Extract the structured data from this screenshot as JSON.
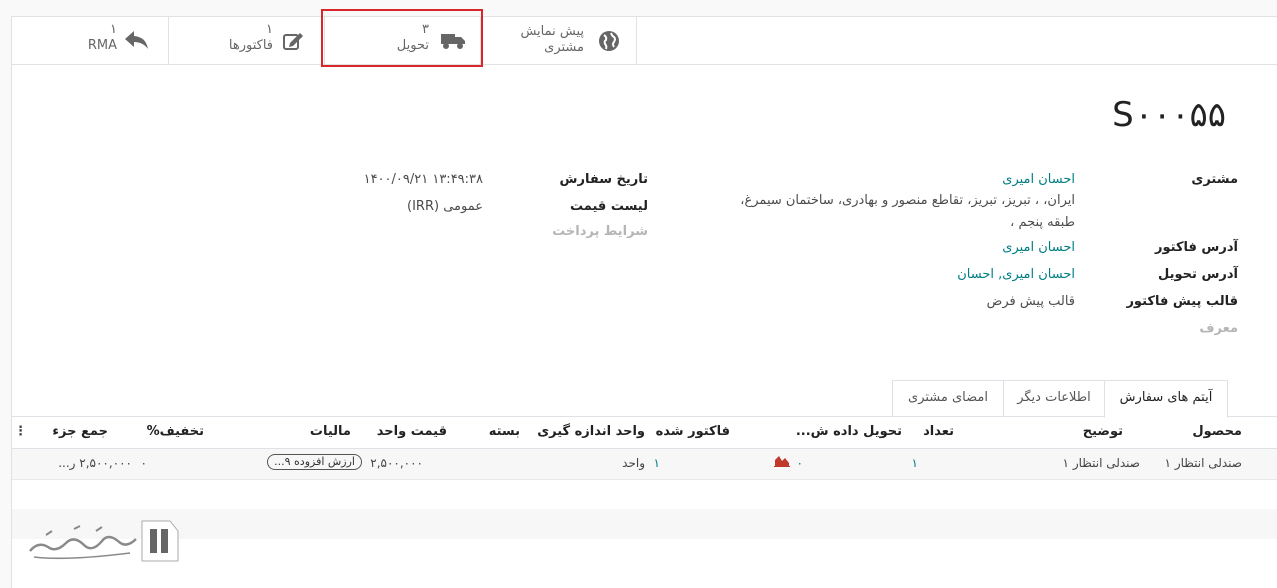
{
  "smart_buttons": {
    "preview": {
      "line1": "پیش نمایش",
      "line2": "مشتری",
      "icon": "globe-icon"
    },
    "delivery": {
      "count": "۳",
      "label": "تحویل",
      "icon": "truck-icon"
    },
    "invoices": {
      "count": "۱",
      "label": "فاکتورها",
      "icon": "pencil-square-icon"
    },
    "rma": {
      "count": "۱",
      "label": "RMA",
      "icon": "reply-arrow-icon"
    }
  },
  "order": {
    "name": "S۰۰۰۵۵"
  },
  "fields": {
    "customer_label": "مشتری",
    "customer_name": "احسان امیری",
    "customer_address_1": "ایران، ، تبریز، تبریز، تقاطع منصور و بهادری، ساختمان سیمرغ،",
    "customer_address_2": "طبقه پنجم ،",
    "invoice_address_label": "آدرس فاکتور",
    "invoice_address_value": "احسان امیری",
    "delivery_address_label": "آدرس تحویل",
    "delivery_address_value": "احسان امیری, احسان",
    "quotation_template_label": "قالب پیش فاکتور",
    "quotation_template_value": "قالب پیش فرض",
    "referrer_label": "معرف",
    "order_date_label": "تاریخ سفارش",
    "order_date_value": "۱۴۰۰/۰۹/۲۱ ۱۳:۴۹:۳۸",
    "pricelist_label": "لیست قیمت",
    "pricelist_value": "عمومی (IRR)",
    "payment_terms_label": "شرایط پرداخت"
  },
  "tabs": [
    {
      "label": "آیتم های سفارش",
      "active": true
    },
    {
      "label": "اطلاعات دیگر",
      "active": false
    },
    {
      "label": "امضای مشتری",
      "active": false
    }
  ],
  "table": {
    "headers": {
      "product": "محصول",
      "description": "توضیح",
      "quantity": "تعداد",
      "delivered": "تحویل داده ش...",
      "invoiced": "فاکتور شده",
      "uom": "واحد اندازه گیری",
      "package": "بسته",
      "unit_price": "قیمت واحد",
      "taxes": "مالیات",
      "discount": "تخفیف%",
      "subtotal": "جمع جزء"
    },
    "rows": [
      {
        "product": "صندلی انتظار ۱",
        "description": "صندلی انتظار ۱",
        "quantity": "۱",
        "delivered": "۰",
        "invoiced": "۱",
        "uom": "واحد",
        "package": "",
        "unit_price": "۲,۵۰۰,۰۰۰",
        "taxes": "ارزش افزوده ۹...",
        "discount": "۰",
        "subtotal": "۲,۵۰۰,۰۰۰ ر..."
      }
    ]
  },
  "colors": {
    "link": "#017e84",
    "highlight": "#d9262b",
    "chart_icon": "#c0392b"
  }
}
